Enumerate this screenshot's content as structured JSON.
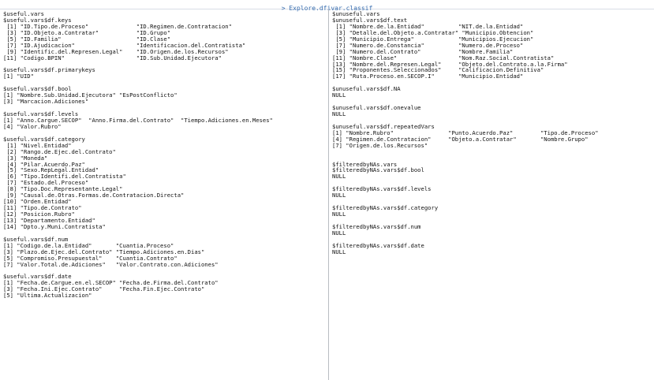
{
  "window": {
    "title": "> Explore.dfivar.classif"
  },
  "left_output": [
    "$useful.vars",
    "$useful.vars$df.keys",
    " [1] \"ID.Tipo.de.Proceso\"              \"ID.Regimen.de.Contratacion\"",
    " [3] \"ID.Objeto.a.Contratar\"           \"ID.Grupo\"",
    " [5] \"ID.Familia\"                      \"ID.Clase\"",
    " [7] \"ID.Ajudicacion\"                  \"Identificacion.del.Contratista\"",
    " [9] \"Identific.del.Represen.Legal\"    \"ID.Origen.de.los.Recursos\"",
    "[11] \"Codigo.BPIN\"                     \"ID.Sub.Unidad.Ejecutora\"",
    "",
    "$useful.vars$df.primarykeys",
    "[1] \"UID\"",
    "",
    "$useful.vars$df.bool",
    "[1] \"Nombre.Sub.Unidad.Ejecutora\" \"EsPostConflicto\"",
    "[3] \"Marcacion.Adiciones\"",
    "",
    "$useful.vars$df.levels",
    "[1] \"Anno.Cargue.SECOP\"  \"Anno.Firma.del.Contrato\"  \"Tiempo.Adiciones.en.Meses\"",
    "[4] \"Valor.Rubro\"",
    "",
    "$useful.vars$df.category",
    " [1] \"Nivel.Entidad\"",
    " [2] \"Rango.de.Ejec.del.Contrato\"",
    " [3] \"Moneda\"",
    " [4] \"Pilar.Acuerdo.Paz\"",
    " [5] \"Sexo.RepLegal.Entidad\"",
    " [6] \"Tipo.Identifi.del.Contratista\"",
    " [7] \"Estado.del.Proceso\"",
    " [8] \"Tipo.Doc.Representante.Legal\"",
    " [9] \"Causal.de.Otras.Formas.de.Contratacion.Directa\"",
    "[10] \"Orden.Entidad\"",
    "[11] \"Tipo.de.Contrato\"",
    "[12] \"Posicion.Rubro\"",
    "[13] \"Departamento.Entidad\"",
    "[14] \"Dpto.y.Muni.Contratista\"",
    "",
    "$useful.vars$df.num",
    "[1] \"Codigo.de.la.Entidad\"       \"Cuantia.Proceso\"",
    "[3] \"Plazo.de.Ejec.del.Contrato\" \"Tiempo.Adiciones.en.Dias\"",
    "[5] \"Compromiso.Presupuestal\"    \"Cuantia.Contrato\"",
    "[7] \"Valor.Total.de.Adiciones\"   \"Valor.Contrato.con.Adiciones\"",
    "",
    "$useful.vars$df.date",
    "[1] \"Fecha.de.Cargue.en.el.SECOP\" \"Fecha.de.Firma.del.Contrato\"",
    "[3] \"Fecha.Ini.Ejec.Contrato\"     \"Fecha.Fin.Ejec.Contrato\"",
    "[5] \"Ultima.Actualizacion\""
  ],
  "right_output": [
    "$unuseful.vars",
    "$unuseful.vars$df.text",
    " [1] \"Nombre.de.la.Entidad\"          \"NIT.de.la.Entidad\"",
    " [3] \"Detalle.del.Objeto.a.Contratar\" \"Municipio.Obtencion\"",
    " [5] \"Municipio.Entrega\"             \"Municipios.Ejecucion\"",
    " [7] \"Numero.de.Constancia\"          \"Numero.de.Proceso\"",
    " [9] \"Numero.del.Contrato\"           \"Nombre.Familia\"",
    "[11] \"Nombre.Clase\"                  \"Nom.Raz.Social.Contratista\"",
    "[13] \"Nombre.del.Represen.Legal\"     \"Objeto.del.Contrato.a.la.Firma\"",
    "[15] \"Proponentes.Seleccionados\"     \"Calificacion.Definitiva\"",
    "[17] \"Ruta.Proceso.en.SECOP.I\"       \"Municipio.Entidad\"",
    "",
    "$unuseful.vars$df.NA",
    "NULL",
    "",
    "$unuseful.vars$df.onevalue",
    "NULL",
    "",
    "$unuseful.vars$df.repeatedVars",
    "[1] \"Nombre.Rubro\"                \"Punto.Acuerdo.Paz\"        \"Tipo.de.Proceso\"",
    "[4] \"Regimen.de.Contratacion\"     \"Objeto.a.Contratar\"       \"Nombre.Grupo\"",
    "[7] \"Origen.de.los.Recursos\"",
    "",
    "",
    "$filteredbyNAs.vars",
    "$filteredbyNAs.vars$df.bool",
    "NULL",
    "",
    "$filteredbyNAs.vars$df.levels",
    "NULL",
    "",
    "$filteredbyNAs.vars$df.category",
    "NULL",
    "",
    "$filteredbyNAs.vars$df.num",
    "NULL",
    "",
    "$filteredbyNAs.vars$df.date",
    "NULL"
  ]
}
